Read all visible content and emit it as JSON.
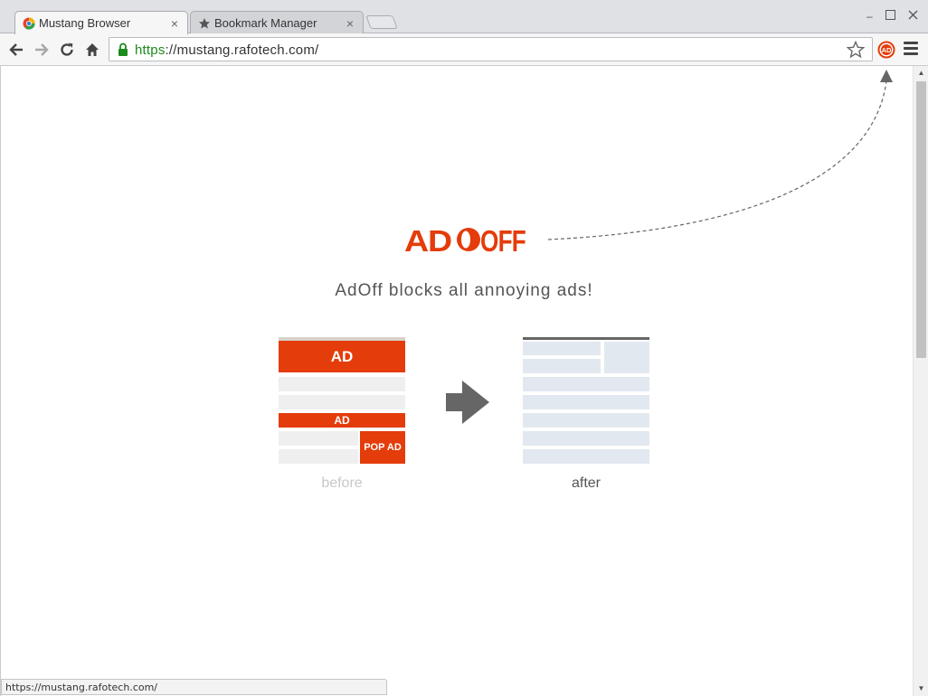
{
  "tabs": [
    {
      "label": "Mustang Browser",
      "close": "×",
      "active": true,
      "icon": "mustang-logo-icon"
    },
    {
      "label": "Bookmark Manager",
      "close": "×",
      "active": false,
      "icon": "star-icon"
    }
  ],
  "window_controls": {
    "minimize": "–",
    "maximize": "☐",
    "close": "✕"
  },
  "address_bar": {
    "scheme": "https",
    "rest": "://mustang.rafotech.com/"
  },
  "page": {
    "logo": {
      "part1": "AD",
      "part2": "OFF"
    },
    "tagline": "AdOff blocks all annoying ads!",
    "before": {
      "label": "before",
      "ad_top": "AD",
      "ad_mid": "AD",
      "pop_ad": "POP AD"
    },
    "after": {
      "label": "after"
    }
  },
  "status_bar": {
    "text": "https://mustang.rafotech.com/"
  },
  "colors": {
    "brand": "#e43c0a",
    "ok_scheme": "#1d8a1d"
  }
}
